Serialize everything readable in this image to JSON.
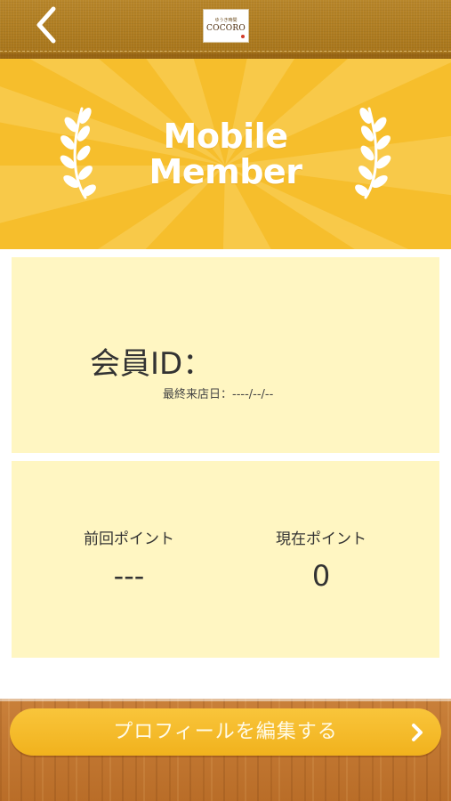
{
  "header": {
    "back_icon": "chevron-left-icon",
    "logo_small": "ゆうき時間",
    "logo_main": "COCORO"
  },
  "banner": {
    "title_line1": "Mobile",
    "title_line2": "Member",
    "decoration_icon": "laurel-icon"
  },
  "member": {
    "id_label": "会員ID：",
    "last_visit_label": "最終来店日：",
    "last_visit_value": "----/--/--"
  },
  "points": {
    "previous_label": "前回ポイント",
    "previous_value": "---",
    "current_label": "現在ポイント",
    "current_value": "0"
  },
  "footer": {
    "edit_profile_label": "プロフィールを編集する",
    "chevron_icon": "chevron-right-icon"
  },
  "colors": {
    "banner_yellow": "#f6be2c",
    "card_cream": "#fff6c2",
    "button_yellow": "#f4b928",
    "header_brown": "#b07c22"
  }
}
